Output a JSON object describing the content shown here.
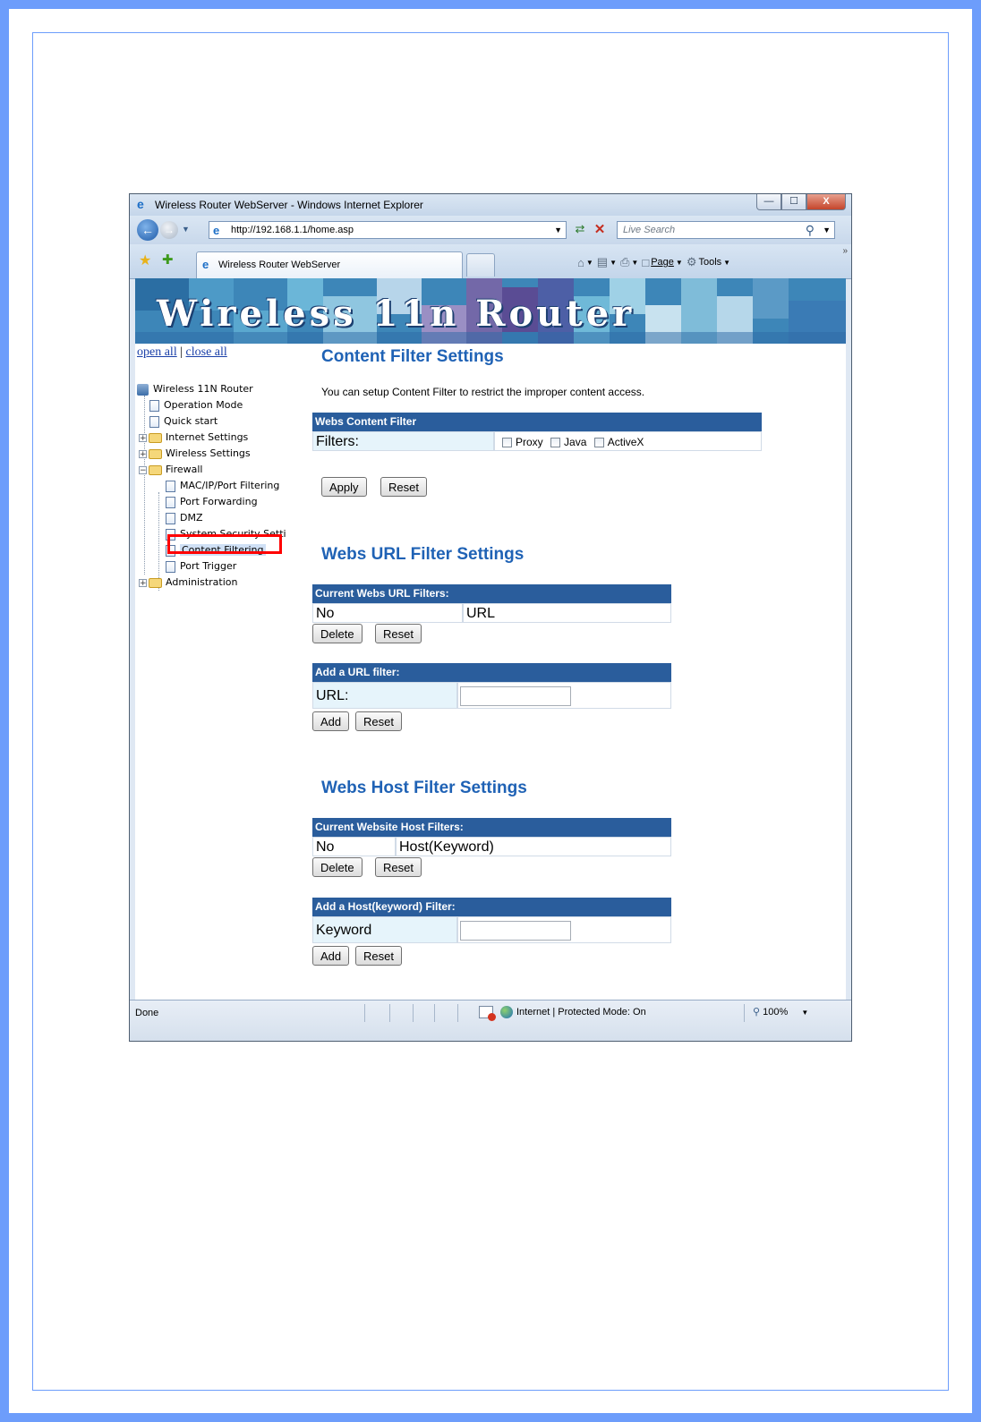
{
  "window": {
    "title": "Wireless Router WebServer - Windows Internet Explorer",
    "controls": {
      "minimize": "—",
      "maximize": "☐",
      "close": "X"
    }
  },
  "address_bar": {
    "url": "http://192.168.1.1/home.asp",
    "search_placeholder": "Live Search"
  },
  "tab": {
    "label": "Wireless Router WebServer"
  },
  "command_bar": {
    "page_label": "Page",
    "tools_label": "Tools"
  },
  "banner": {
    "title": "Wireless 11n Router"
  },
  "sidebar": {
    "open_all": "open all",
    "separator": "|",
    "close_all": "close all",
    "root": "Wireless 11N Router",
    "items": [
      {
        "label": "Operation Mode",
        "type": "doc"
      },
      {
        "label": "Quick start",
        "type": "doc"
      },
      {
        "label": "Internet Settings",
        "type": "folder"
      },
      {
        "label": "Wireless Settings",
        "type": "folder"
      },
      {
        "label": "Firewall",
        "type": "folder-open"
      },
      {
        "label": "MAC/IP/Port Filtering",
        "type": "doc"
      },
      {
        "label": "Port Forwarding",
        "type": "doc"
      },
      {
        "label": "DMZ",
        "type": "doc"
      },
      {
        "label": "System Security Setti",
        "type": "doc"
      },
      {
        "label": "Content Filtering",
        "type": "doc"
      },
      {
        "label": "Port Trigger",
        "type": "doc"
      },
      {
        "label": "Administration",
        "type": "folder"
      }
    ],
    "selected": "Content Filtering"
  },
  "content_filter": {
    "title": "Content Filter Settings",
    "intro": "You can setup Content Filter to restrict the improper content access.",
    "table_header": "Webs Content Filter",
    "filters_label": "Filters:",
    "options": [
      "Proxy",
      "Java",
      "ActiveX"
    ],
    "apply": "Apply",
    "reset": "Reset"
  },
  "url_filter": {
    "title": "Webs URL Filter Settings",
    "current_header": "Current Webs URL Filters:",
    "col_no": "No",
    "col_url": "URL",
    "delete": "Delete",
    "reset": "Reset",
    "add_header": "Add a URL filter:",
    "url_label": "URL:",
    "url_value": "",
    "add": "Add",
    "add_reset": "Reset"
  },
  "host_filter": {
    "title": "Webs Host Filter Settings",
    "current_header": "Current Website Host Filters:",
    "col_no": "No",
    "col_host": "Host(Keyword)",
    "delete": "Delete",
    "reset": "Reset",
    "add_header": "Add a Host(keyword) Filter:",
    "keyword_label": "Keyword",
    "keyword_value": "",
    "add": "Add",
    "add_reset": "Reset"
  },
  "status_bar": {
    "status": "Done",
    "zone": "Internet | Protected Mode: On",
    "zoom": "100%"
  }
}
